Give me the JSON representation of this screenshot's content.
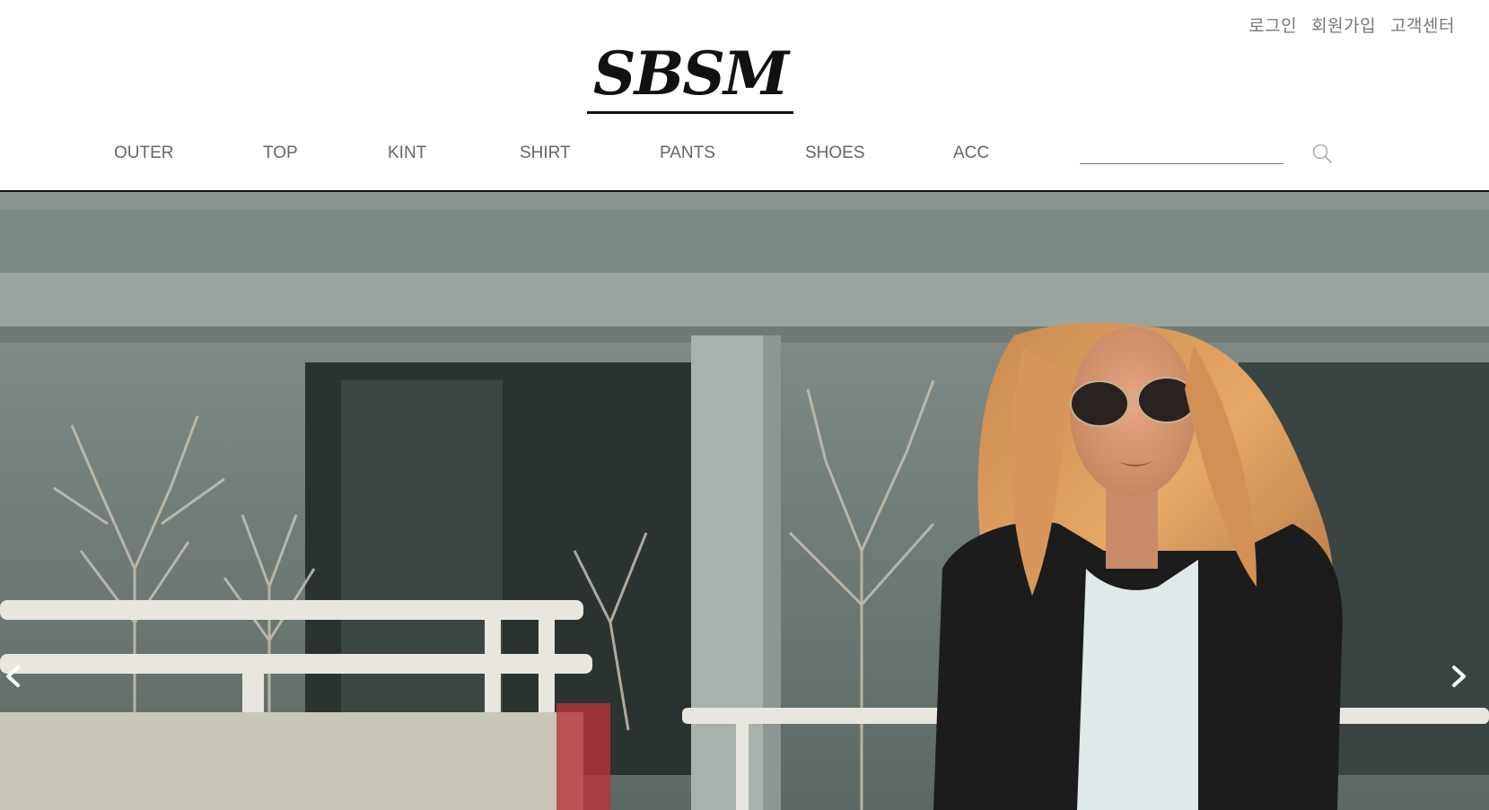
{
  "header": {
    "util_links": [
      "로그인",
      "회원가입",
      "고객센터"
    ],
    "logo_text": "SBSM",
    "nav": [
      "OUTER",
      "TOP",
      "KINT",
      "SHIRT",
      "PANTS",
      "SHOES",
      "ACC"
    ],
    "search": {
      "value": "",
      "placeholder": ""
    }
  },
  "hero": {
    "image": "fashion-model-photo",
    "prev_icon": "chevron-left-icon",
    "next_icon": "chevron-right-icon"
  },
  "colors": {
    "nav_text": "#666666",
    "util_text": "#777777",
    "logo": "#111111",
    "header_border": "#111111"
  }
}
